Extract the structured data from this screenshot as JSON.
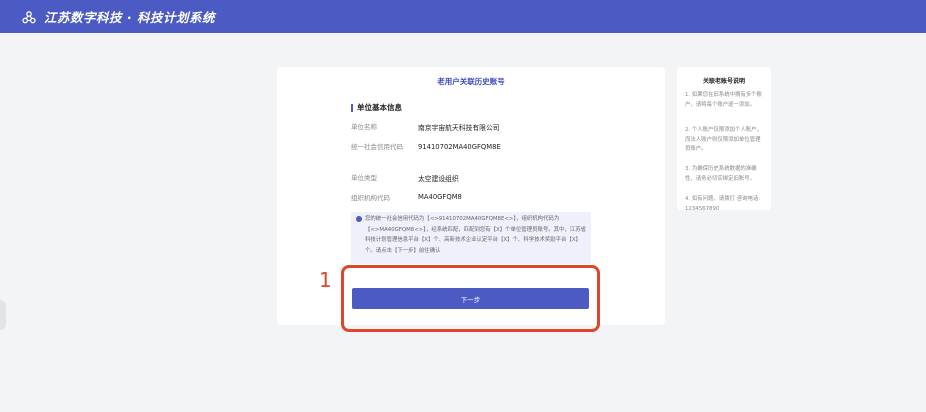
{
  "header": {
    "app_title": "江苏数字科技 · 科技计划系统",
    "logo_icon": "share-nodes-icon"
  },
  "card": {
    "title": "老用户关联历史账号",
    "section_title": "单位基本信息",
    "fields": [
      {
        "label": "单位名称",
        "value": "南京宇宙航天科技有限公司"
      },
      {
        "label": "统一社会信用代码",
        "value": "91410702MA40GFQM8E"
      },
      {
        "label": "单位类型",
        "value": "太空建设组织"
      },
      {
        "label": "组织机构代码",
        "value": "MA40GFQM8"
      }
    ],
    "notice": "您的统一社会信用代码为【<>91410702MA40GFQM8E<>】，组织机构代码为【<>MA40GFQM8<>】，经系统匹配，匹配到您有【X】个单位管理员账号。其中，江苏省科技计划管理信息平台【X】个、高新技术企业认定平台【X】个、科学技术奖励平台【X】个。请点击【下一步】前往确认",
    "next_button": "下一步"
  },
  "annotation": {
    "number": "1",
    "color": "#e0442b"
  },
  "side_panel": {
    "title": "关联老账号说明",
    "items": [
      "1. 如果您在旧系统中拥有多个账户，请将每个账户逐一添加。",
      "2. 个人账户仅限添加个人账户，而法人账户则仅限添加单位管理员账户。",
      "3. 为确保历史系统数据的准确性，请务必切实绑定旧账号。",
      "4. 如有问题，请拨打 咨询电话: 1234567890"
    ]
  },
  "colors": {
    "brand": "#4c5ac4",
    "annotation": "#e0442b"
  }
}
